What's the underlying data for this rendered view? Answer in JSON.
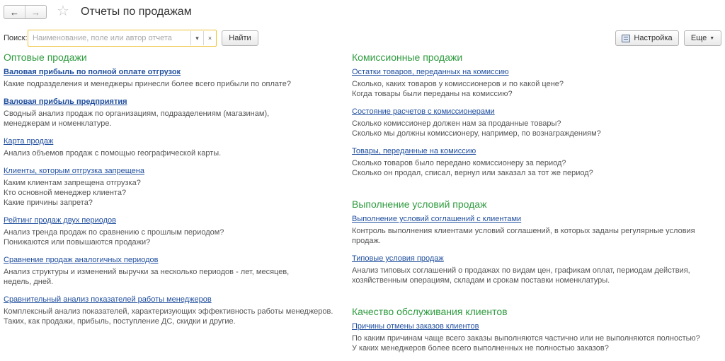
{
  "title": "Отчеты по продажам",
  "nav": {
    "back": "←",
    "forward": "→",
    "star": "☆"
  },
  "search": {
    "label": "Поиск:",
    "placeholder": "Наименование, поле или автор отчета",
    "value": "",
    "dropdown": "▾",
    "clear": "×",
    "find": "Найти"
  },
  "toolbar": {
    "settings": "Настройка",
    "more": "Еще"
  },
  "left": {
    "sections": [
      {
        "title": "Оптовые продажи",
        "items": [
          {
            "link": "Валовая прибыль по полной оплате отгрузок",
            "bold": true,
            "desc": "Какие подразделения и менеджеры принесли более всего прибыли по оплате?"
          },
          {
            "link": "Валовая прибыль предприятия",
            "bold": true,
            "desc": "Сводный анализ продаж по организациям, подразделениям (магазинам),\nменеджерам и номенклатуре."
          },
          {
            "link": "Карта продаж",
            "bold": false,
            "desc": "Анализ объемов продаж с помощью географической карты."
          },
          {
            "link": "Клиенты, которым отгрузка запрещена",
            "bold": false,
            "desc": "Каким клиентам запрещена отгрузка?\nКто основной менеджер клиента?\nКакие причины запрета?"
          },
          {
            "link": "Рейтинг продаж двух периодов",
            "bold": false,
            "desc": "Анализ тренда продаж по сравнению с прошлым периодом?\nПонижаются или повышаются продажи?"
          },
          {
            "link": "Сравнение продаж аналогичных периодов",
            "bold": false,
            "desc": "Анализ структуры и изменений выручки за несколько периодов - лет, месяцев,\nнедель, дней."
          },
          {
            "link": "Сравнительный анализ показателей работы менеджеров",
            "bold": false,
            "desc": "Комплексный анализ показателей, характеризующих эффективность работы менеджеров.\nТаких, как продажи, прибыль, поступление ДС, скидки и другие."
          }
        ]
      }
    ]
  },
  "right": {
    "sections": [
      {
        "title": "Комиссионные продажи",
        "items": [
          {
            "link": "Остатки товаров, переданных на комиссию",
            "bold": false,
            "desc": "Сколько, каких товаров у комиссионеров и по какой цене?\nКогда товары были переданы на комиссию?"
          },
          {
            "link": "Состояние расчетов с комиссионерами",
            "bold": false,
            "desc": "Сколько комиссионер должен нам за проданные товары?\nСколько мы должны комиссионеру, например, по вознаграждениям?"
          },
          {
            "link": "Товары, переданные на комиссию",
            "bold": false,
            "desc": "Сколько товаров было передано комиссионеру за период?\nСколько он продал, списал, вернул или заказал за тот же период?"
          }
        ]
      },
      {
        "title": "Выполнение условий продаж",
        "items": [
          {
            "link": "Выполнение условий соглашений с клиентами",
            "bold": false,
            "desc": "Контроль выполнения клиентами условий соглашений, в которых заданы регулярные условия продаж."
          },
          {
            "link": "Типовые условия продаж",
            "bold": false,
            "desc": "Анализ типовых соглашений о продажах по видам цен, графикам оплат, периодам действия,\nхозяйственным операциям, складам и срокам поставки номенклатуры."
          }
        ]
      },
      {
        "title": "Качество обслуживания клиентов",
        "items": [
          {
            "link": "Причины отмены заказов клиентов",
            "bold": false,
            "desc": "По каким причинам чаще всего заказы выполняются частично или не выполняются полностью?\nУ каких менеджеров более всего выполненных не полностью заказов?"
          }
        ]
      }
    ]
  },
  "colors": {
    "section_title": "#2e9b3f",
    "link": "#1f4e9e",
    "search_border": "#f1c232"
  }
}
